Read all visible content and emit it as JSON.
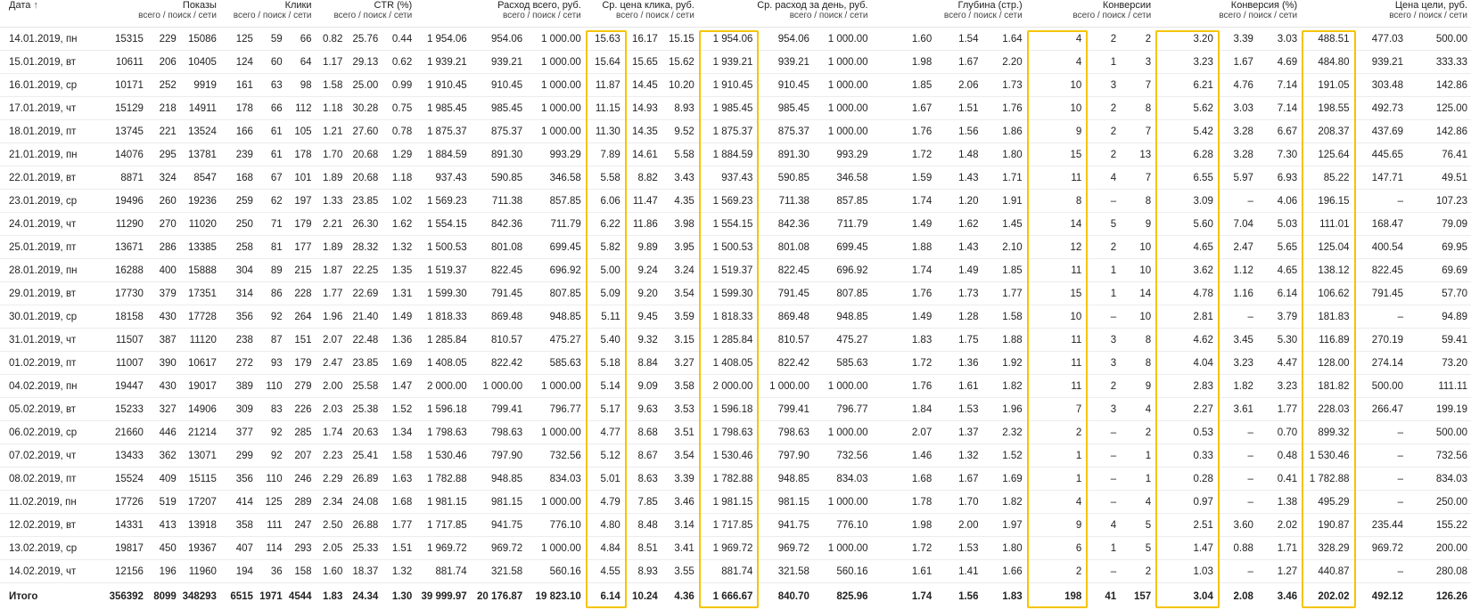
{
  "highlight_color": "#f5c400",
  "header": {
    "date": "Дата",
    "sort_icon": "arrow-up",
    "sort_glyph": "↑",
    "groups": [
      {
        "title": "Показы",
        "sub": "всего / поиск / сети"
      },
      {
        "title": "Клики",
        "sub": "всего / поиск / сети"
      },
      {
        "title": "CTR (%)",
        "sub": "всего / поиск / сети"
      },
      {
        "title": "Расход всего, руб.",
        "sub": "всего / поиск / сети"
      },
      {
        "title": "Ср. цена клика, руб.",
        "sub": "всего / поиск / сети"
      },
      {
        "title": "Ср. расход за день, руб.",
        "sub": "всего / поиск / сети"
      },
      {
        "title": "Глубина (стр.)",
        "sub": "всего / поиск / сети"
      },
      {
        "title": "Конверсии",
        "sub": "всего / поиск / сети"
      },
      {
        "title": "Конверсия (%)",
        "sub": "всего / поиск / сети"
      },
      {
        "title": "Цена цели, руб.",
        "sub": "всего / поиск / сети"
      }
    ]
  },
  "rows": [
    {
      "date": "14.01.2019, пн",
      "cells": [
        "15315",
        "229",
        "15086",
        "125",
        "59",
        "66",
        "0.82",
        "25.76",
        "0.44",
        "1 954.06",
        "954.06",
        "1 000.00",
        "15.63",
        "16.17",
        "15.15",
        "1 954.06",
        "954.06",
        "1 000.00",
        "1.60",
        "1.54",
        "1.64",
        "4",
        "2",
        "2",
        "3.20",
        "3.39",
        "3.03",
        "488.51",
        "477.03",
        "500.00"
      ]
    },
    {
      "date": "15.01.2019, вт",
      "cells": [
        "10611",
        "206",
        "10405",
        "124",
        "60",
        "64",
        "1.17",
        "29.13",
        "0.62",
        "1 939.21",
        "939.21",
        "1 000.00",
        "15.64",
        "15.65",
        "15.62",
        "1 939.21",
        "939.21",
        "1 000.00",
        "1.98",
        "1.67",
        "2.20",
        "4",
        "1",
        "3",
        "3.23",
        "1.67",
        "4.69",
        "484.80",
        "939.21",
        "333.33"
      ]
    },
    {
      "date": "16.01.2019, ср",
      "cells": [
        "10171",
        "252",
        "9919",
        "161",
        "63",
        "98",
        "1.58",
        "25.00",
        "0.99",
        "1 910.45",
        "910.45",
        "1 000.00",
        "11.87",
        "14.45",
        "10.20",
        "1 910.45",
        "910.45",
        "1 000.00",
        "1.85",
        "2.06",
        "1.73",
        "10",
        "3",
        "7",
        "6.21",
        "4.76",
        "7.14",
        "191.05",
        "303.48",
        "142.86"
      ]
    },
    {
      "date": "17.01.2019, чт",
      "cells": [
        "15129",
        "218",
        "14911",
        "178",
        "66",
        "112",
        "1.18",
        "30.28",
        "0.75",
        "1 985.45",
        "985.45",
        "1 000.00",
        "11.15",
        "14.93",
        "8.93",
        "1 985.45",
        "985.45",
        "1 000.00",
        "1.67",
        "1.51",
        "1.76",
        "10",
        "2",
        "8",
        "5.62",
        "3.03",
        "7.14",
        "198.55",
        "492.73",
        "125.00"
      ]
    },
    {
      "date": "18.01.2019, пт",
      "cells": [
        "13745",
        "221",
        "13524",
        "166",
        "61",
        "105",
        "1.21",
        "27.60",
        "0.78",
        "1 875.37",
        "875.37",
        "1 000.00",
        "11.30",
        "14.35",
        "9.52",
        "1 875.37",
        "875.37",
        "1 000.00",
        "1.76",
        "1.56",
        "1.86",
        "9",
        "2",
        "7",
        "5.42",
        "3.28",
        "6.67",
        "208.37",
        "437.69",
        "142.86"
      ]
    },
    {
      "date": "21.01.2019, пн",
      "cells": [
        "14076",
        "295",
        "13781",
        "239",
        "61",
        "178",
        "1.70",
        "20.68",
        "1.29",
        "1 884.59",
        "891.30",
        "993.29",
        "7.89",
        "14.61",
        "5.58",
        "1 884.59",
        "891.30",
        "993.29",
        "1.72",
        "1.48",
        "1.80",
        "15",
        "2",
        "13",
        "6.28",
        "3.28",
        "7.30",
        "125.64",
        "445.65",
        "76.41"
      ]
    },
    {
      "date": "22.01.2019, вт",
      "cells": [
        "8871",
        "324",
        "8547",
        "168",
        "67",
        "101",
        "1.89",
        "20.68",
        "1.18",
        "937.43",
        "590.85",
        "346.58",
        "5.58",
        "8.82",
        "3.43",
        "937.43",
        "590.85",
        "346.58",
        "1.59",
        "1.43",
        "1.71",
        "11",
        "4",
        "7",
        "6.55",
        "5.97",
        "6.93",
        "85.22",
        "147.71",
        "49.51"
      ]
    },
    {
      "date": "23.01.2019, ср",
      "cells": [
        "19496",
        "260",
        "19236",
        "259",
        "62",
        "197",
        "1.33",
        "23.85",
        "1.02",
        "1 569.23",
        "711.38",
        "857.85",
        "6.06",
        "11.47",
        "4.35",
        "1 569.23",
        "711.38",
        "857.85",
        "1.74",
        "1.20",
        "1.91",
        "8",
        "–",
        "8",
        "3.09",
        "–",
        "4.06",
        "196.15",
        "–",
        "107.23"
      ]
    },
    {
      "date": "24.01.2019, чт",
      "cells": [
        "11290",
        "270",
        "11020",
        "250",
        "71",
        "179",
        "2.21",
        "26.30",
        "1.62",
        "1 554.15",
        "842.36",
        "711.79",
        "6.22",
        "11.86",
        "3.98",
        "1 554.15",
        "842.36",
        "711.79",
        "1.49",
        "1.62",
        "1.45",
        "14",
        "5",
        "9",
        "5.60",
        "7.04",
        "5.03",
        "111.01",
        "168.47",
        "79.09"
      ]
    },
    {
      "date": "25.01.2019, пт",
      "cells": [
        "13671",
        "286",
        "13385",
        "258",
        "81",
        "177",
        "1.89",
        "28.32",
        "1.32",
        "1 500.53",
        "801.08",
        "699.45",
        "5.82",
        "9.89",
        "3.95",
        "1 500.53",
        "801.08",
        "699.45",
        "1.88",
        "1.43",
        "2.10",
        "12",
        "2",
        "10",
        "4.65",
        "2.47",
        "5.65",
        "125.04",
        "400.54",
        "69.95"
      ]
    },
    {
      "date": "28.01.2019, пн",
      "cells": [
        "16288",
        "400",
        "15888",
        "304",
        "89",
        "215",
        "1.87",
        "22.25",
        "1.35",
        "1 519.37",
        "822.45",
        "696.92",
        "5.00",
        "9.24",
        "3.24",
        "1 519.37",
        "822.45",
        "696.92",
        "1.74",
        "1.49",
        "1.85",
        "11",
        "1",
        "10",
        "3.62",
        "1.12",
        "4.65",
        "138.12",
        "822.45",
        "69.69"
      ]
    },
    {
      "date": "29.01.2019, вт",
      "cells": [
        "17730",
        "379",
        "17351",
        "314",
        "86",
        "228",
        "1.77",
        "22.69",
        "1.31",
        "1 599.30",
        "791.45",
        "807.85",
        "5.09",
        "9.20",
        "3.54",
        "1 599.30",
        "791.45",
        "807.85",
        "1.76",
        "1.73",
        "1.77",
        "15",
        "1",
        "14",
        "4.78",
        "1.16",
        "6.14",
        "106.62",
        "791.45",
        "57.70"
      ]
    },
    {
      "date": "30.01.2019, ср",
      "cells": [
        "18158",
        "430",
        "17728",
        "356",
        "92",
        "264",
        "1.96",
        "21.40",
        "1.49",
        "1 818.33",
        "869.48",
        "948.85",
        "5.11",
        "9.45",
        "3.59",
        "1 818.33",
        "869.48",
        "948.85",
        "1.49",
        "1.28",
        "1.58",
        "10",
        "–",
        "10",
        "2.81",
        "–",
        "3.79",
        "181.83",
        "–",
        "94.89"
      ]
    },
    {
      "date": "31.01.2019, чт",
      "cells": [
        "11507",
        "387",
        "11120",
        "238",
        "87",
        "151",
        "2.07",
        "22.48",
        "1.36",
        "1 285.84",
        "810.57",
        "475.27",
        "5.40",
        "9.32",
        "3.15",
        "1 285.84",
        "810.57",
        "475.27",
        "1.83",
        "1.75",
        "1.88",
        "11",
        "3",
        "8",
        "4.62",
        "3.45",
        "5.30",
        "116.89",
        "270.19",
        "59.41"
      ]
    },
    {
      "date": "01.02.2019, пт",
      "cells": [
        "11007",
        "390",
        "10617",
        "272",
        "93",
        "179",
        "2.47",
        "23.85",
        "1.69",
        "1 408.05",
        "822.42",
        "585.63",
        "5.18",
        "8.84",
        "3.27",
        "1 408.05",
        "822.42",
        "585.63",
        "1.72",
        "1.36",
        "1.92",
        "11",
        "3",
        "8",
        "4.04",
        "3.23",
        "4.47",
        "128.00",
        "274.14",
        "73.20"
      ]
    },
    {
      "date": "04.02.2019, пн",
      "cells": [
        "19447",
        "430",
        "19017",
        "389",
        "110",
        "279",
        "2.00",
        "25.58",
        "1.47",
        "2 000.00",
        "1 000.00",
        "1 000.00",
        "5.14",
        "9.09",
        "3.58",
        "2 000.00",
        "1 000.00",
        "1 000.00",
        "1.76",
        "1.61",
        "1.82",
        "11",
        "2",
        "9",
        "2.83",
        "1.82",
        "3.23",
        "181.82",
        "500.00",
        "111.11"
      ]
    },
    {
      "date": "05.02.2019, вт",
      "cells": [
        "15233",
        "327",
        "14906",
        "309",
        "83",
        "226",
        "2.03",
        "25.38",
        "1.52",
        "1 596.18",
        "799.41",
        "796.77",
        "5.17",
        "9.63",
        "3.53",
        "1 596.18",
        "799.41",
        "796.77",
        "1.84",
        "1.53",
        "1.96",
        "7",
        "3",
        "4",
        "2.27",
        "3.61",
        "1.77",
        "228.03",
        "266.47",
        "199.19"
      ]
    },
    {
      "date": "06.02.2019, ср",
      "cells": [
        "21660",
        "446",
        "21214",
        "377",
        "92",
        "285",
        "1.74",
        "20.63",
        "1.34",
        "1 798.63",
        "798.63",
        "1 000.00",
        "4.77",
        "8.68",
        "3.51",
        "1 798.63",
        "798.63",
        "1 000.00",
        "2.07",
        "1.37",
        "2.32",
        "2",
        "–",
        "2",
        "0.53",
        "–",
        "0.70",
        "899.32",
        "–",
        "500.00"
      ]
    },
    {
      "date": "07.02.2019, чт",
      "cells": [
        "13433",
        "362",
        "13071",
        "299",
        "92",
        "207",
        "2.23",
        "25.41",
        "1.58",
        "1 530.46",
        "797.90",
        "732.56",
        "5.12",
        "8.67",
        "3.54",
        "1 530.46",
        "797.90",
        "732.56",
        "1.46",
        "1.32",
        "1.52",
        "1",
        "–",
        "1",
        "0.33",
        "–",
        "0.48",
        "1 530.46",
        "–",
        "732.56"
      ]
    },
    {
      "date": "08.02.2019, пт",
      "cells": [
        "15524",
        "409",
        "15115",
        "356",
        "110",
        "246",
        "2.29",
        "26.89",
        "1.63",
        "1 782.88",
        "948.85",
        "834.03",
        "5.01",
        "8.63",
        "3.39",
        "1 782.88",
        "948.85",
        "834.03",
        "1.68",
        "1.67",
        "1.69",
        "1",
        "–",
        "1",
        "0.28",
        "–",
        "0.41",
        "1 782.88",
        "–",
        "834.03"
      ]
    },
    {
      "date": "11.02.2019, пн",
      "cells": [
        "17726",
        "519",
        "17207",
        "414",
        "125",
        "289",
        "2.34",
        "24.08",
        "1.68",
        "1 981.15",
        "981.15",
        "1 000.00",
        "4.79",
        "7.85",
        "3.46",
        "1 981.15",
        "981.15",
        "1 000.00",
        "1.78",
        "1.70",
        "1.82",
        "4",
        "–",
        "4",
        "0.97",
        "–",
        "1.38",
        "495.29",
        "–",
        "250.00"
      ]
    },
    {
      "date": "12.02.2019, вт",
      "cells": [
        "14331",
        "413",
        "13918",
        "358",
        "111",
        "247",
        "2.50",
        "26.88",
        "1.77",
        "1 717.85",
        "941.75",
        "776.10",
        "4.80",
        "8.48",
        "3.14",
        "1 717.85",
        "941.75",
        "776.10",
        "1.98",
        "2.00",
        "1.97",
        "9",
        "4",
        "5",
        "2.51",
        "3.60",
        "2.02",
        "190.87",
        "235.44",
        "155.22"
      ]
    },
    {
      "date": "13.02.2019, ср",
      "cells": [
        "19817",
        "450",
        "19367",
        "407",
        "114",
        "293",
        "2.05",
        "25.33",
        "1.51",
        "1 969.72",
        "969.72",
        "1 000.00",
        "4.84",
        "8.51",
        "3.41",
        "1 969.72",
        "969.72",
        "1 000.00",
        "1.72",
        "1.53",
        "1.80",
        "6",
        "1",
        "5",
        "1.47",
        "0.88",
        "1.71",
        "328.29",
        "969.72",
        "200.00"
      ]
    },
    {
      "date": "14.02.2019, чт",
      "cells": [
        "12156",
        "196",
        "11960",
        "194",
        "36",
        "158",
        "1.60",
        "18.37",
        "1.32",
        "881.74",
        "321.58",
        "560.16",
        "4.55",
        "8.93",
        "3.55",
        "881.74",
        "321.58",
        "560.16",
        "1.61",
        "1.41",
        "1.66",
        "2",
        "–",
        "2",
        "1.03",
        "–",
        "1.27",
        "440.87",
        "–",
        "280.08"
      ]
    }
  ],
  "total": {
    "label": "Итого",
    "cells": [
      "356392",
      "8099",
      "348293",
      "6515",
      "1971",
      "4544",
      "1.83",
      "24.34",
      "1.30",
      "39 999.97",
      "20 176.87",
      "19 823.10",
      "6.14",
      "10.24",
      "4.36",
      "1 666.67",
      "840.70",
      "825.96",
      "1.74",
      "1.56",
      "1.83",
      "198",
      "41",
      "157",
      "3.04",
      "2.08",
      "3.46",
      "202.02",
      "492.12",
      "126.26"
    ]
  }
}
